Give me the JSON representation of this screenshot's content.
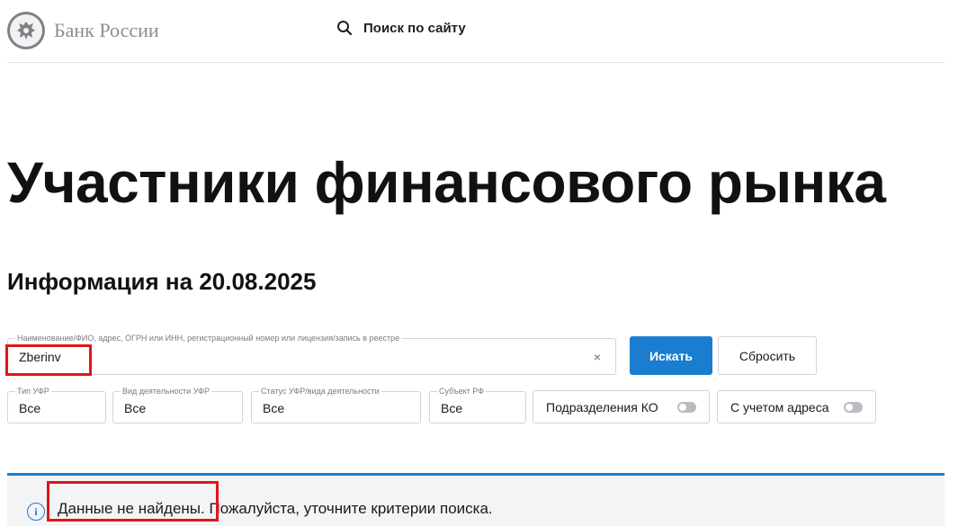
{
  "header": {
    "logo_text": "Банк России",
    "site_search_label": "Поиск по сайту"
  },
  "page": {
    "title": "Участники финансового рынка",
    "info_date": "Информация на 20.08.2025"
  },
  "search": {
    "label": "Наименование/ФИО, адрес, ОГРН или ИНН, регистрационный номер или лицензия/запись в реестре",
    "value": "Zberinv",
    "clear_symbol": "×",
    "submit_label": "Искать",
    "reset_label": "Сбросить"
  },
  "filters": [
    {
      "label": "Тип УФР",
      "value": "Все"
    },
    {
      "label": "Вид деятельности УФР",
      "value": "Все"
    },
    {
      "label": "Статус УФР/вида деятельности",
      "value": "Все"
    },
    {
      "label": "Субъект РФ",
      "value": "Все"
    }
  ],
  "toggles": [
    {
      "label": "Подразделения КО",
      "on": false
    },
    {
      "label": "С учетом адреса",
      "on": false
    }
  ],
  "result": {
    "message_part1": "Данные не найдены.",
    "message_part2": " Пожалуйста, уточните критерии поиска.",
    "icon_text": "i"
  },
  "colors": {
    "accent": "#1a7dcf",
    "highlight": "#e3141b"
  }
}
